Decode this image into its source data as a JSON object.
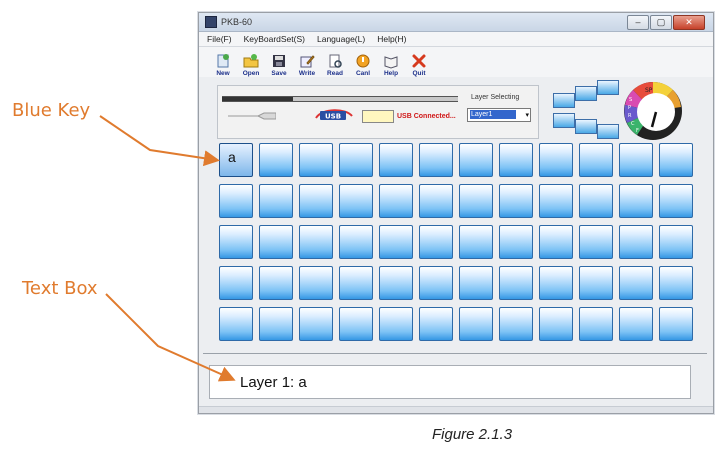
{
  "annotations": {
    "blue_key": "Blue Key",
    "text_box": "Text Box",
    "caption": "Figure 2.1.3",
    "color": "#e07b2e"
  },
  "window": {
    "title": "PKB-60",
    "controls": [
      "–",
      "▢",
      "✕"
    ]
  },
  "menu": [
    "File(F)",
    "KeyBoardSet(S)",
    "Language(L)",
    "Help(H)"
  ],
  "toolbar": [
    {
      "label": "New",
      "icon": "new-file-icon"
    },
    {
      "label": "Open",
      "icon": "open-folder-icon"
    },
    {
      "label": "Save",
      "icon": "floppy-disk-icon"
    },
    {
      "label": "Write",
      "icon": "write-pencil-icon"
    },
    {
      "label": "Read",
      "icon": "read-document-icon"
    },
    {
      "label": "Canl",
      "icon": "cancel-circle-icon"
    },
    {
      "label": "Help",
      "icon": "help-book-icon"
    },
    {
      "label": "Quit",
      "icon": "quit-x-icon"
    }
  ],
  "status": {
    "progress": 0.3,
    "usb_status": "USB Connected...",
    "usb_logo": "USB"
  },
  "layer": {
    "label": "Layer Selecting",
    "selected": "Layer1",
    "arrow": "▾"
  },
  "dial": {
    "sp_label": "SP",
    "letters": [
      "S",
      "P",
      "R",
      "C",
      "F"
    ]
  },
  "grid": {
    "rows": 5,
    "cols": 12,
    "first_key_label": "a"
  },
  "text_box": {
    "value": "Layer 1: a"
  }
}
